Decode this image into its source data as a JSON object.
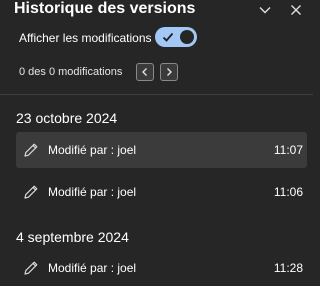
{
  "panel": {
    "title": "Historique des versions",
    "minimize_icon": "chevron-down-icon",
    "close_icon": "close-icon"
  },
  "toggle": {
    "label": "Afficher les modifications",
    "on": true,
    "accent": "#a3c8f5"
  },
  "changes": {
    "count_text": "0 des 0 modifications"
  },
  "groups": [
    {
      "date": "23 octobre 2024",
      "items": [
        {
          "label": "Modifié par : joel",
          "time": "11:07",
          "selected": true
        },
        {
          "label": "Modifié par : joel",
          "time": "11:06",
          "selected": false
        }
      ]
    },
    {
      "date": "4 septembre 2024",
      "items": [
        {
          "label": "Modifié par : joel",
          "time": "11:28",
          "selected": false
        }
      ]
    }
  ]
}
